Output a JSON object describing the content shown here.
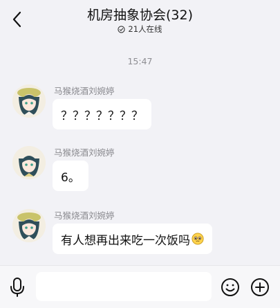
{
  "header": {
    "title": "机房抽象协会(32)",
    "online_status": "21人在线"
  },
  "chat": {
    "timestamp": "15:47",
    "messages": [
      {
        "sender": "马猴烧酒刘婉婷",
        "text": "？？？？？？？"
      },
      {
        "sender": "马猴烧酒刘婉婷",
        "text": "6。"
      },
      {
        "sender": "马猴烧酒刘婉婷",
        "text": "有人想再出来吃一次饭吗"
      }
    ]
  },
  "input": {
    "value": "",
    "placeholder": ""
  },
  "icons": {
    "back": "chevron-left-icon",
    "online": "online-status-icon",
    "emoji_in_message": "pleading-face-emoji",
    "mic": "microphone-icon",
    "emoji": "smiley-icon",
    "plus": "plus-circle-icon"
  },
  "colors": {
    "background": "#f2f2f6",
    "bubble": "#ffffff",
    "text_primary": "#111111",
    "text_secondary": "#8a8a8f"
  }
}
